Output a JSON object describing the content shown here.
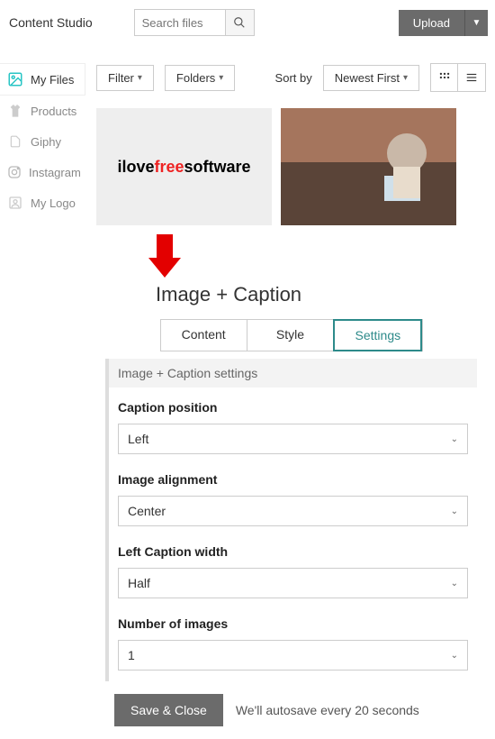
{
  "header": {
    "app_title": "Content Studio",
    "search_placeholder": "Search files",
    "upload_label": "Upload"
  },
  "sidebar": {
    "items": [
      {
        "label": "My Files"
      },
      {
        "label": "Products"
      },
      {
        "label": "Giphy"
      },
      {
        "label": "Instagram"
      },
      {
        "label": "My Logo"
      }
    ]
  },
  "toolbar": {
    "filter_label": "Filter",
    "folders_label": "Folders",
    "sort_by_label": "Sort by",
    "newest_first_label": "Newest First"
  },
  "thumbs": {
    "logo_prefix": "ilove",
    "logo_mid": "free",
    "logo_suffix": "software"
  },
  "section": {
    "title": "Image + Caption"
  },
  "tabs": {
    "content": "Content",
    "style": "Style",
    "settings": "Settings"
  },
  "panel": {
    "header": "Image + Caption settings",
    "fields": {
      "caption_position": {
        "label": "Caption position",
        "value": "Left"
      },
      "image_alignment": {
        "label": "Image alignment",
        "value": "Center"
      },
      "left_caption_width": {
        "label": "Left Caption width",
        "value": "Half"
      },
      "number_of_images": {
        "label": "Number of images",
        "value": "1"
      }
    }
  },
  "footer": {
    "save_label": "Save & Close",
    "autosave_text": "We'll autosave every 20 seconds"
  }
}
